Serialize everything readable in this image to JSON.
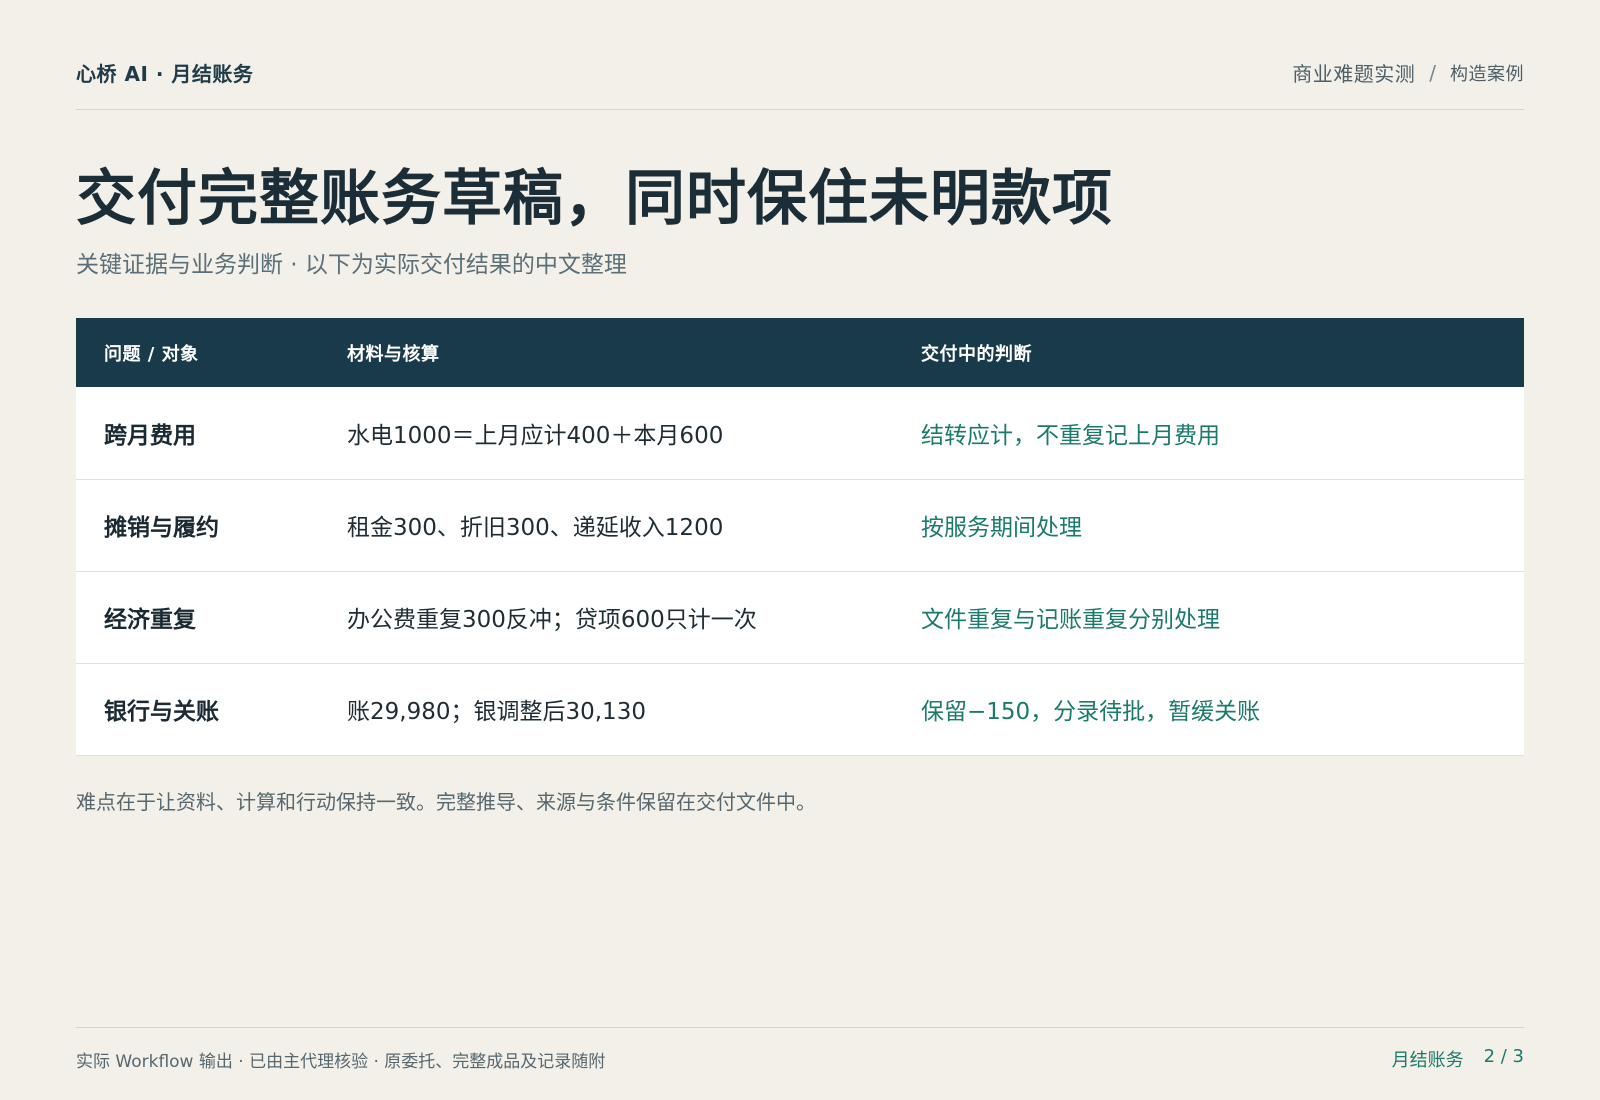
{
  "header": {
    "brand": "心桥 AI · 月结账务",
    "nav_primary": "商业难题实测",
    "nav_separator": "/",
    "nav_secondary": "构造案例"
  },
  "title": "交付完整账务草稿，同时保住未明款项",
  "subtitle": "关键证据与业务判断 · 以下为实际交付结果的中文整理",
  "table": {
    "headers": [
      "问题 / 对象",
      "材料与核算",
      "交付中的判断"
    ],
    "rows": [
      {
        "topic": "跨月费用",
        "calc": "水电1000＝上月应计400＋本月600",
        "judge": "结转应计，不重复记上月费用"
      },
      {
        "topic": "摊销与履约",
        "calc": "租金300、折旧300、递延收入1200",
        "judge": "按服务期间处理"
      },
      {
        "topic": "经济重复",
        "calc": "办公费重复300反冲；贷项600只计一次",
        "judge": "文件重复与记账重复分别处理"
      },
      {
        "topic": "银行与关账",
        "calc": "账29,980；银调整后30,130",
        "judge": "保留−150，分录待批，暂缓关账"
      }
    ]
  },
  "note": "难点在于让资料、计算和行动保持一致。完整推导、来源与条件保留在交付文件中。",
  "footer": {
    "left": "实际 Workflow 输出 · 已由主代理核验 · 原委托、完整成品及记录随附",
    "section": "月结账务",
    "page": "2 / 3"
  },
  "colors": {
    "background": "#f3f0ea",
    "header_bar": "#183a4a",
    "accent": "#1b7a6b"
  }
}
